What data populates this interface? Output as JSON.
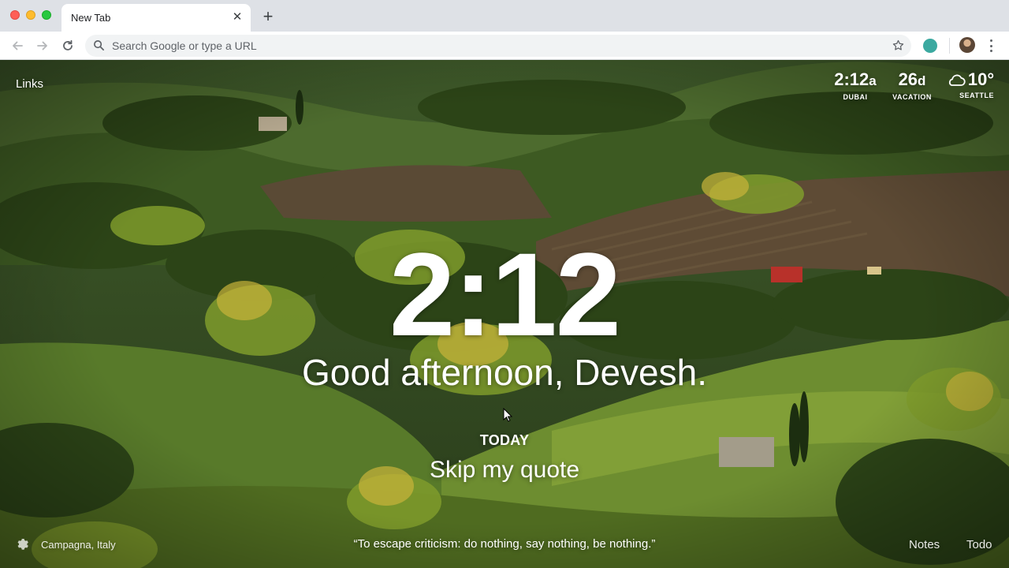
{
  "browser": {
    "tab_title": "New Tab",
    "omnibox_placeholder": "Search Google or type a URL"
  },
  "dashboard": {
    "links_label": "Links",
    "widgets": [
      {
        "main": "2:12",
        "suffix": "a",
        "label": "DUBAI"
      },
      {
        "main": "26",
        "suffix": "d",
        "label": "VACATION"
      },
      {
        "main": "10°",
        "suffix": "",
        "label": "SEATTLE",
        "icon": "cloud-icon"
      }
    ],
    "clock": "2:12",
    "greeting": "Good afternoon, Devesh.",
    "focus_heading": "TODAY",
    "focus_text": "Skip my quote",
    "location": "Campagna, Italy",
    "quote": "“To escape criticism: do nothing, say nothing, be nothing.”",
    "notes_label": "Notes",
    "todo_label": "Todo"
  },
  "colors": {
    "tabstrip": "#dee1e6",
    "extension": "#3ba9a0"
  }
}
